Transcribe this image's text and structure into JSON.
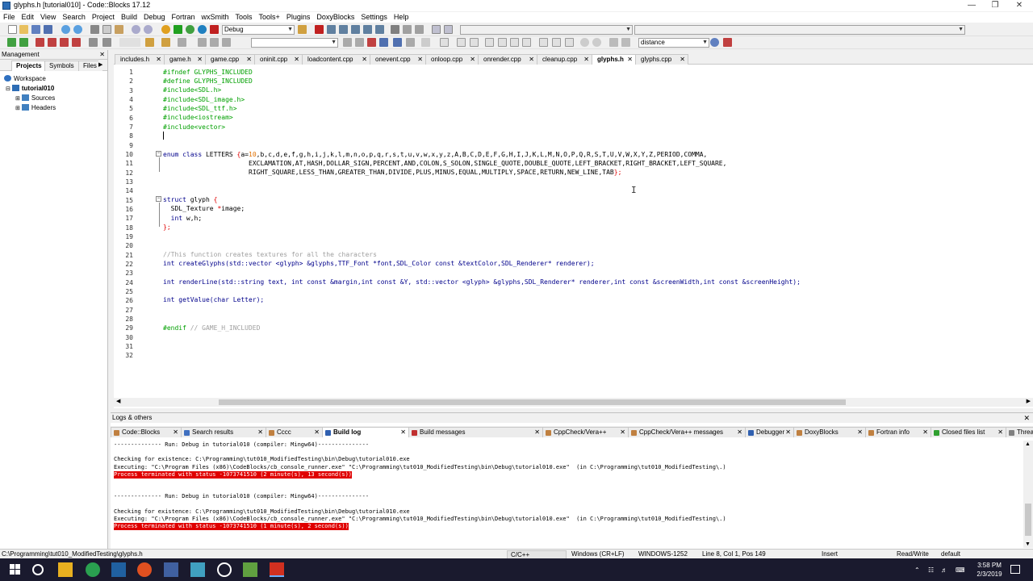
{
  "window": {
    "title": "glyphs.h [tutorial010] - Code::Blocks 17.12"
  },
  "menu": [
    "File",
    "Edit",
    "View",
    "Search",
    "Project",
    "Build",
    "Debug",
    "Fortran",
    "wxSmith",
    "Tools",
    "Tools+",
    "Plugins",
    "DoxyBlocks",
    "Settings",
    "Help"
  ],
  "toolbar": {
    "build_target": "Debug",
    "search_value": "distance"
  },
  "management": {
    "title": "Management",
    "tabs": [
      "Projects",
      "Symbols",
      "Files"
    ],
    "tree": {
      "workspace": "Workspace",
      "project": "tutorial010",
      "sources": "Sources",
      "headers": "Headers"
    }
  },
  "editor_tabs": [
    {
      "label": "includes.h"
    },
    {
      "label": "game.h"
    },
    {
      "label": "game.cpp"
    },
    {
      "label": "oninit.cpp"
    },
    {
      "label": "loadcontent.cpp"
    },
    {
      "label": "onevent.cpp"
    },
    {
      "label": "onloop.cpp"
    },
    {
      "label": "onrender.cpp"
    },
    {
      "label": "cleanup.cpp"
    },
    {
      "label": "glyphs.h",
      "active": true
    },
    {
      "label": "glyphs.cpp"
    }
  ],
  "line_numbers": [
    "1",
    "2",
    "3",
    "4",
    "5",
    "6",
    "7",
    "8",
    "9",
    "10",
    "11",
    "12",
    "13",
    "14",
    "15",
    "16",
    "17",
    "18",
    "19",
    "20",
    "21",
    "22",
    "23",
    "24",
    "25",
    "26",
    "27",
    "28",
    "29",
    "30",
    "31",
    "32"
  ],
  "code": {
    "l1": "#ifndef GLYPHS_INCLUDED",
    "l2": "#define GLYPHS_INCLUDED",
    "l3": "#include<SDL.h>",
    "l4": "#include<SDL_image.h>",
    "l5": "#include<SDL_ttf.h>",
    "l6": "#include<iostream>",
    "l7": "#include<vector>",
    "l10_kw": "enum class",
    "l10_name": " LETTERS ",
    "l10_open": "{",
    "l10_a": "a=",
    "l10_num": "10",
    "l10_rest": ",b,c,d,e,f,g,h,i,j,k,l,m,n,o,p,q,r,s,t,u,v,w,x,y,z,A,B,C,D,E,F,G,H,I,J,K,L,M,N,O,P,Q,R,S,T,U,V,W,X,Y,Z,PERIOD,COMMA,",
    "l11": "EXCLAMATION,AT,HASH,DOLLAR_SIGN,PERCENT,AND,COLON,S_SOLON,SINGLE_QUOTE,DOUBLE_QUOTE,LEFT_BRACKET,RIGHT_BRACKET,LEFT_SQUARE,",
    "l12": "RIGHT_SQUARE,LESS_THAN,GREATER_THAN,DIVIDE,PLUS,MINUS,EQUAL,MULTIPLY,SPACE,RETURN,NEW_LINE,TAB",
    "l12_end": "};",
    "l15_kw": "struct",
    "l15_name": " glyph ",
    "l15_open": "{",
    "l16": "  SDL_Texture ",
    "l16_star": "*",
    "l16_rest": "image;",
    "l17_kw": "  int",
    "l17_rest": " w,h;",
    "l18": "};",
    "l21": "//This function creates textures for all the characters",
    "l22": "int createGlyphs(std::vector <glyph> &glyphs,TTF_Font *font,SDL_Color const &textColor,SDL_Renderer* renderer);",
    "l24": "int renderLine(std::string text, int const &margin,int const &Y, std::vector <glyph> &glyphs,SDL_Renderer* renderer,int const &screenWidth,int const &screenHeight);",
    "l26": "int getValue(char Letter);",
    "l29_pp": "#endif",
    "l29_cm": " // GAME_H_INCLUDED"
  },
  "logs": {
    "title": "Logs & others",
    "tabs": [
      {
        "label": "Code::Blocks",
        "color": "#c08040"
      },
      {
        "label": "Search results",
        "color": "#4070c0"
      },
      {
        "label": "Cccc",
        "color": "#c08040"
      },
      {
        "label": "Build log",
        "color": "#3060b0",
        "active": true
      },
      {
        "label": "Build messages",
        "color": "#c03030"
      },
      {
        "label": "CppCheck/Vera++",
        "color": "#c08040"
      },
      {
        "label": "CppCheck/Vera++ messages",
        "color": "#c08040"
      },
      {
        "label": "Debugger",
        "color": "#3060b0"
      },
      {
        "label": "DoxyBlocks",
        "color": "#c08040"
      },
      {
        "label": "Fortran info",
        "color": "#c08040"
      },
      {
        "label": "Closed files list",
        "color": "#30a030"
      },
      {
        "label": "Thread search",
        "color": "#808080"
      }
    ],
    "lines": [
      {
        "text": "-------------- Run: Debug in tutorial010 (compiler: Mingw64)---------------",
        "err": false
      },
      {
        "text": "",
        "err": false
      },
      {
        "text": "Checking for existence: C:\\Programming\\tut010_ModifiedTesting\\bin\\Debug\\tutorial010.exe",
        "err": false
      },
      {
        "text": "Executing: \"C:\\Program Files (x86)\\CodeBlocks/cb_console_runner.exe\" \"C:\\Programming\\tut010_ModifiedTesting\\bin\\Debug\\tutorial010.exe\"  (in C:\\Programming\\tut010_ModifiedTesting\\.)",
        "err": false
      },
      {
        "text": "Process terminated with status -1073741510 (2 minute(s), 13 second(s))",
        "err": true
      },
      {
        "text": "",
        "err": false
      },
      {
        "text": "",
        "err": false
      },
      {
        "text": "-------------- Run: Debug in tutorial010 (compiler: Mingw64)---------------",
        "err": false
      },
      {
        "text": "",
        "err": false
      },
      {
        "text": "Checking for existence: C:\\Programming\\tut010_ModifiedTesting\\bin\\Debug\\tutorial010.exe",
        "err": false
      },
      {
        "text": "Executing: \"C:\\Program Files (x86)\\CodeBlocks/cb_console_runner.exe\" \"C:\\Programming\\tut010_ModifiedTesting\\bin\\Debug\\tutorial010.exe\"  (in C:\\Programming\\tut010_ModifiedTesting\\.)",
        "err": false
      },
      {
        "text": "Process terminated with status -1073741510 (1 minute(s), 2 second(s))",
        "err": true
      }
    ]
  },
  "status": {
    "path": "C:\\Programming\\tut010_ModifiedTesting\\glyphs.h",
    "language": "C/C++",
    "eol": "Windows (CR+LF)",
    "encoding": "WINDOWS-1252",
    "position": "Line 8, Col 1, Pos 149",
    "mode": "Insert",
    "access": "Read/Write",
    "profile": "default"
  },
  "taskbar": {
    "time": "3:58 PM",
    "date": "2/3/2019"
  },
  "colors": {
    "preprocessor": "#00a000",
    "keyword": "#00008b",
    "comment": "#a0a0a0",
    "error_bg": "#e00000"
  }
}
